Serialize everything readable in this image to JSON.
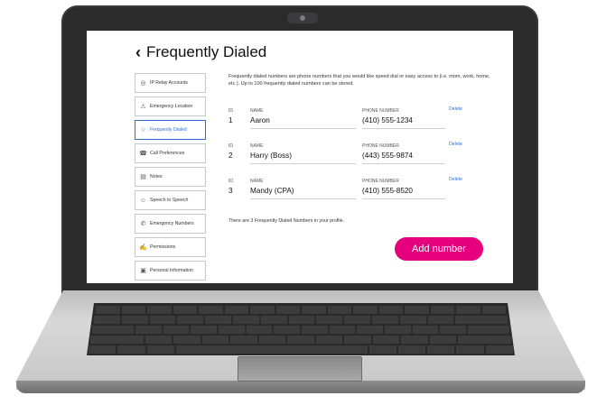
{
  "header": {
    "back_icon": "chevron-left-icon",
    "title": "Frequently Dialed"
  },
  "sidebar": {
    "items": [
      {
        "label": "IP Relay Accounts",
        "icon": "ip-relay-icon",
        "glyph": "◎"
      },
      {
        "label": "Emergency Location",
        "icon": "warning-icon",
        "glyph": "⚠"
      },
      {
        "label": "Frequently Dialed",
        "icon": "star-icon",
        "glyph": "☆",
        "active": true
      },
      {
        "label": "Call Preferences",
        "icon": "phone-settings-icon",
        "glyph": "☎"
      },
      {
        "label": "Notes",
        "icon": "notes-icon",
        "glyph": "▤"
      },
      {
        "label": "Speech to Speech",
        "icon": "speech-icon",
        "glyph": "☺"
      },
      {
        "label": "Emergency Numbers",
        "icon": "emergency-icon",
        "glyph": "✆"
      },
      {
        "label": "Permissions",
        "icon": "permissions-icon",
        "glyph": "✍"
      },
      {
        "label": "Personal Information",
        "icon": "id-card-icon",
        "glyph": "▣"
      }
    ]
  },
  "main": {
    "intro": "Frequently dialed numbers are phone numbers that you would like speed dial or easy access to (i.e. mom, work, home, etc.). Up to 100 frequently dialed numbers can be stored.",
    "column_id": "ID",
    "column_name": "NAME",
    "column_phone": "PHONE NUMBER",
    "delete_label": "Delete",
    "entries": [
      {
        "id": "1",
        "name": "Aaron",
        "phone": "(410) 555-1234"
      },
      {
        "id": "2",
        "name": "Harry (Boss)",
        "phone": "(443) 555-9874"
      },
      {
        "id": "3",
        "name": "Mandy (CPA)",
        "phone": "(410) 555-8520"
      }
    ],
    "count_note": "There are 3 Frequently Dialed Numbers in your profile.",
    "add_button": "Add number",
    "add_button_color": "#e6007e",
    "link_color": "#2f6fd6"
  }
}
